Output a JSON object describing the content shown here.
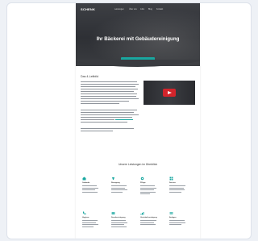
{
  "site": {
    "logo": "SCHENK",
    "nav": [
      "Leistungen",
      "Über uns",
      "Jobs",
      "Blog",
      "Kontakt"
    ]
  },
  "hero": {
    "title": "Ihr Bäckerei mit Gebäudereinigung",
    "subtitle": "",
    "note": "",
    "cta_label": ""
  },
  "intro": {
    "title": "Das 4-Leitbild",
    "link_text": ""
  },
  "video": {
    "caption": ""
  },
  "services": {
    "title": "Unsere Leistungen im Überblick",
    "items": [
      {
        "name": "Gebäude",
        "icon": "building-icon"
      },
      {
        "name": "Reinigung",
        "icon": "broom-icon"
      },
      {
        "name": "Pflege",
        "icon": "gear-icon"
      },
      {
        "name": "Service",
        "icon": "grid-icon"
      },
      {
        "name": "Hygiene",
        "icon": "phone-icon"
      },
      {
        "name": "Sonderreinigung",
        "icon": "card-icon"
      },
      {
        "name": "Unterhaltsreinigung",
        "icon": "chart-icon"
      },
      {
        "name": "Anlagen",
        "icon": "list-icon"
      }
    ]
  },
  "colors": {
    "accent": "#19a7a0",
    "hero_dark": "#2e3035",
    "play": "#d3242b"
  }
}
